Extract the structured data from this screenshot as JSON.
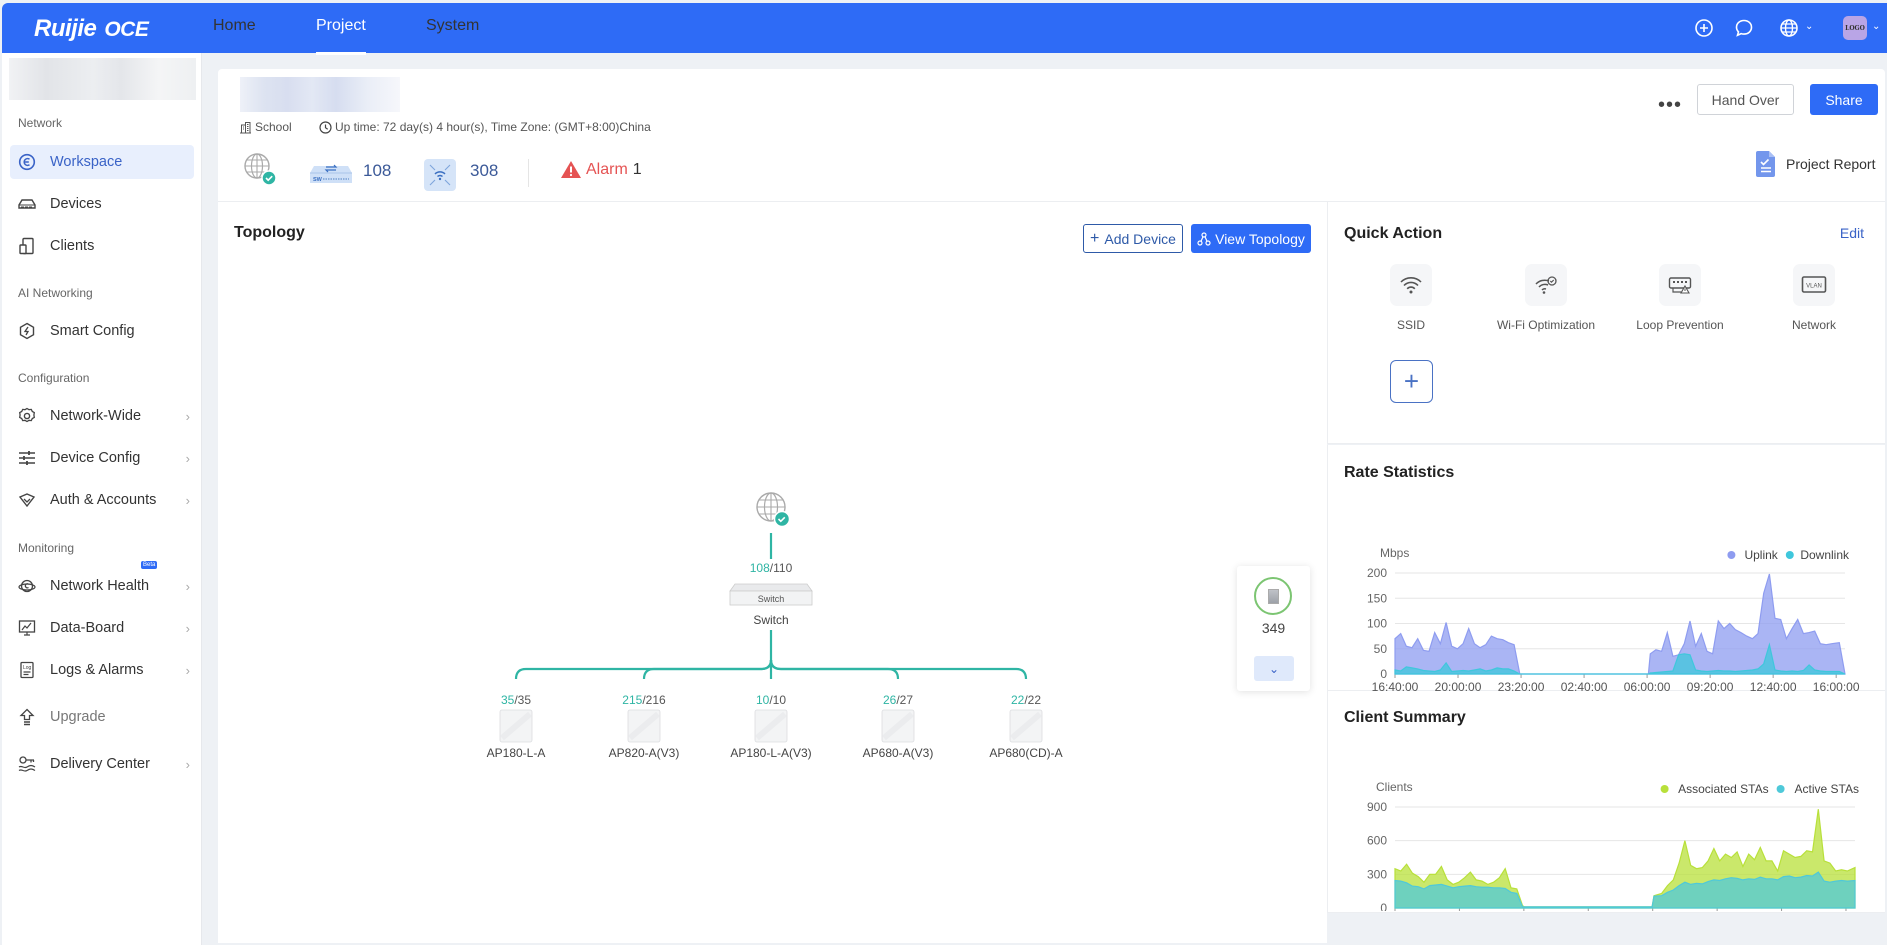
{
  "app": {
    "brand": "Ruijie",
    "brand_sub": "OCE",
    "nav": [
      {
        "label": "Home",
        "active": false
      },
      {
        "label": "Project",
        "active": true
      },
      {
        "label": "System",
        "active": false
      }
    ],
    "top_icons": [
      "add-circle-icon",
      "message-icon",
      "globe-icon",
      "avatar"
    ],
    "avatar_text": "LOGO"
  },
  "sidebar": {
    "sections": [
      {
        "label": "Network",
        "items": [
          {
            "label": "Workspace",
            "icon": "workspace-icon",
            "active": true,
            "has_children": false
          },
          {
            "label": "Devices",
            "icon": "devices-icon",
            "active": false,
            "has_children": false
          },
          {
            "label": "Clients",
            "icon": "clients-icon",
            "active": false,
            "has_children": false
          }
        ]
      },
      {
        "label": "AI Networking",
        "items": [
          {
            "label": "Smart Config",
            "icon": "smart-config-icon",
            "active": false,
            "has_children": false
          }
        ]
      },
      {
        "label": "Configuration",
        "items": [
          {
            "label": "Network-Wide",
            "icon": "gear-icon",
            "active": false,
            "has_children": true
          },
          {
            "label": "Device Config",
            "icon": "sliders-icon",
            "active": false,
            "has_children": true
          },
          {
            "label": "Auth & Accounts",
            "icon": "shield-icon",
            "active": false,
            "has_children": true
          }
        ]
      },
      {
        "label": "Monitoring",
        "items": [
          {
            "label": "Network Health",
            "icon": "network-health-icon",
            "active": false,
            "has_children": true,
            "badge": "Beta"
          },
          {
            "label": "Data-Board",
            "icon": "data-board-icon",
            "active": false,
            "has_children": true
          },
          {
            "label": "Logs & Alarms",
            "icon": "logs-icon",
            "active": false,
            "has_children": true
          },
          {
            "label": "Upgrade",
            "icon": "upgrade-icon",
            "active": false,
            "has_children": false
          },
          {
            "label": "Delivery Center",
            "icon": "delivery-icon",
            "active": false,
            "has_children": true
          }
        ]
      }
    ]
  },
  "project": {
    "scene": "School",
    "uptime": "Up time: 72 day(s) 4 hour(s), Time Zone: (GMT+8:00)China",
    "switch_count": "108",
    "ap_count": "308",
    "alarm_label": "Alarm",
    "alarm_count": "1",
    "more_label": "•••",
    "hand_over_label": "Hand Over",
    "share_label": "Share",
    "report_label": "Project Report"
  },
  "topology": {
    "title": "Topology",
    "add_device_label": "Add Device",
    "view_topology_label": "View Topology",
    "gateway": {
      "status": "online"
    },
    "switch": {
      "online": "108",
      "total": "110",
      "label": "Switch",
      "device_text": "Switch"
    },
    "aps": [
      {
        "online": "35",
        "total": "35",
        "label": "AP180-L-A"
      },
      {
        "online": "215",
        "total": "216",
        "label": "AP820-A(V3)"
      },
      {
        "online": "10",
        "total": "10",
        "label": "AP180-L-A(V3)"
      },
      {
        "online": "26",
        "total": "27",
        "label": "AP680-A(V3)"
      },
      {
        "online": "22",
        "total": "22",
        "label": "AP680(CD)-A"
      }
    ],
    "side_panel": {
      "count": "349"
    },
    "colors": {
      "link": "#2fb5a4",
      "online": "#2fb5a4"
    }
  },
  "quick_action": {
    "title": "Quick Action",
    "edit_label": "Edit",
    "items": [
      {
        "label": "SSID",
        "icon": "wifi-icon"
      },
      {
        "label": "Wi-Fi Optimization",
        "icon": "wifi-optimization-icon"
      },
      {
        "label": "Loop Prevention",
        "icon": "loop-prevention-icon"
      },
      {
        "label": "Network",
        "icon": "vlan-icon"
      }
    ],
    "add_label": "+"
  },
  "rate_stats": {
    "title": "Rate Statistics"
  },
  "client_summary": {
    "title": "Client Summary"
  },
  "chart_data": [
    {
      "type": "area",
      "title": "Rate Statistics",
      "ylabel": "Mbps",
      "xlabel": "",
      "ylim": [
        0,
        200
      ],
      "yticks": [
        0,
        50,
        100,
        150,
        200
      ],
      "x_ticks": [
        "16:40:00",
        "20:00:00",
        "23:20:00",
        "02:40:00",
        "06:00:00",
        "09:20:00",
        "12:40:00",
        "16:00:00"
      ],
      "legend_position": "top-right",
      "grid": true,
      "x_hours": [
        0,
        0.3,
        0.6,
        0.9,
        1.2,
        1.5,
        1.8,
        2.1,
        2.4,
        2.7,
        3.0,
        3.3,
        3.6,
        3.9,
        4.2,
        4.5,
        4.8,
        5.1,
        5.4,
        5.7,
        6.0,
        6.3,
        6.6,
        7.0,
        10.0,
        13.4,
        13.5,
        13.8,
        14.1,
        14.4,
        14.7,
        15.0,
        15.3,
        15.6,
        15.9,
        16.2,
        16.5,
        16.8,
        17.1,
        17.4,
        17.7,
        18.0,
        18.3,
        18.6,
        18.9,
        19.2,
        19.5,
        19.8,
        20.1,
        20.4,
        20.7,
        21.0,
        21.3,
        21.6,
        21.9,
        22.2,
        22.5,
        22.8,
        23.1,
        23.5,
        23.8
      ],
      "series": [
        {
          "name": "Uplink",
          "color": "#8e9cf0",
          "values": [
            70,
            80,
            55,
            52,
            70,
            47,
            45,
            82,
            60,
            102,
            55,
            50,
            60,
            90,
            60,
            52,
            58,
            75,
            70,
            68,
            62,
            58,
            0,
            0,
            0,
            0,
            40,
            48,
            45,
            82,
            35,
            38,
            60,
            105,
            55,
            80,
            45,
            40,
            105,
            90,
            100,
            88,
            82,
            75,
            70,
            80,
            160,
            198,
            110,
            108,
            70,
            90,
            108,
            80,
            82,
            85,
            60,
            58,
            60,
            62,
            0
          ]
        },
        {
          "name": "Downlink",
          "color": "#3fc7dc",
          "values": [
            8,
            6,
            14,
            12,
            10,
            7,
            6,
            5,
            8,
            22,
            5,
            6,
            7,
            6,
            8,
            10,
            6,
            8,
            12,
            10,
            10,
            6,
            0,
            0,
            0,
            0,
            2,
            3,
            4,
            5,
            6,
            38,
            40,
            38,
            8,
            6,
            5,
            6,
            7,
            6,
            6,
            5,
            6,
            7,
            8,
            10,
            20,
            58,
            8,
            6,
            5,
            6,
            5,
            7,
            18,
            8,
            6,
            5,
            5,
            5,
            0
          ]
        }
      ]
    },
    {
      "type": "area",
      "title": "Client Summary",
      "ylabel": "Clients",
      "xlabel": "",
      "ylim": [
        0,
        900
      ],
      "yticks": [
        0,
        300,
        600,
        900
      ],
      "x_ticks": [
        "16:40:00",
        "20:00:00",
        "23:20:00",
        "02:40:00",
        "06:00:00",
        "09:20:00",
        "12:40:00",
        "16:00:00"
      ],
      "legend_position": "top-right",
      "grid": true,
      "x_hours": [
        0,
        0.3,
        0.6,
        0.9,
        1.2,
        1.5,
        1.8,
        2.1,
        2.4,
        2.7,
        3.0,
        3.3,
        3.6,
        3.9,
        4.2,
        4.5,
        4.8,
        5.1,
        5.4,
        5.7,
        6.0,
        6.3,
        6.6,
        6.7,
        10.0,
        13.3,
        13.4,
        13.8,
        14.1,
        14.4,
        14.7,
        15.0,
        15.3,
        15.6,
        15.9,
        16.2,
        16.5,
        16.8,
        17.1,
        17.4,
        17.7,
        18.0,
        18.3,
        18.6,
        18.9,
        19.2,
        19.5,
        19.8,
        20.1,
        20.4,
        20.7,
        21.0,
        21.3,
        21.6,
        21.9,
        22.2,
        22.5,
        22.8,
        23.1,
        23.4,
        23.8
      ],
      "series": [
        {
          "name": "Associated STAs",
          "color": "#b8e03a",
          "values": [
            350,
            330,
            390,
            310,
            280,
            230,
            300,
            300,
            370,
            250,
            210,
            230,
            270,
            320,
            250,
            240,
            210,
            230,
            270,
            350,
            180,
            170,
            20,
            10,
            10,
            10,
            110,
            130,
            200,
            250,
            400,
            600,
            380,
            350,
            360,
            420,
            530,
            420,
            480,
            450,
            500,
            370,
            480,
            430,
            540,
            420,
            420,
            330,
            510,
            480,
            450,
            460,
            510,
            500,
            880,
            420,
            400,
            330,
            340,
            330,
            360
          ]
        },
        {
          "name": "Active STAs",
          "color": "#4fc9d9",
          "values": [
            245,
            240,
            225,
            195,
            190,
            170,
            200,
            205,
            210,
            195,
            180,
            190,
            195,
            200,
            190,
            185,
            185,
            180,
            180,
            175,
            140,
            130,
            10,
            10,
            10,
            10,
            105,
            110,
            140,
            160,
            200,
            230,
            210,
            220,
            215,
            235,
            250,
            245,
            260,
            270,
            265,
            250,
            260,
            255,
            275,
            260,
            260,
            250,
            280,
            285,
            270,
            275,
            290,
            285,
            320,
            240,
            230,
            240,
            245,
            240,
            245
          ]
        }
      ]
    }
  ]
}
